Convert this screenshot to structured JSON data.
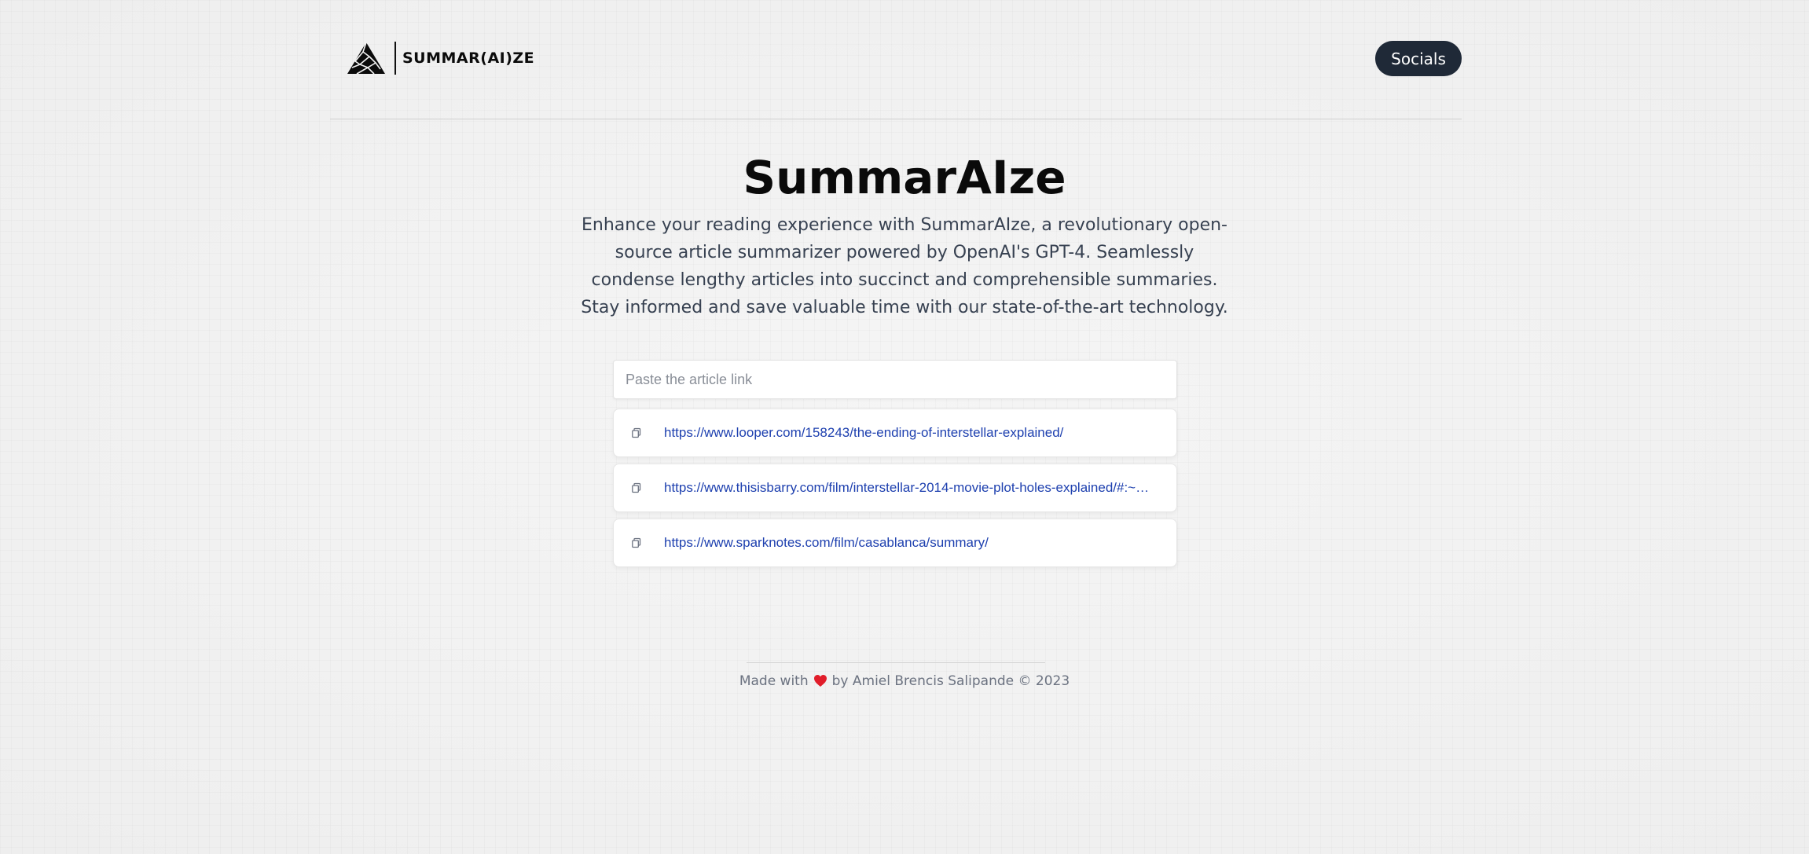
{
  "navbar": {
    "logo_text": "SUMMAR(AI)ZE",
    "socials_label": "Socials"
  },
  "hero": {
    "title": "SummarAIze",
    "description": "Enhance your reading experience with SummarAIze, a revolutionary open-source article summarizer powered by OpenAI's GPT-4. Seamlessly condense lengthy articles into succinct and comprehensible summaries. Stay informed and save valuable time with our state-of-the-art technology."
  },
  "search": {
    "placeholder": "Paste the article link",
    "value": ""
  },
  "history": [
    {
      "url": "https://www.looper.com/158243/the-ending-of-interstellar-explained/",
      "icon": "copy-icon"
    },
    {
      "url": "https://www.thisisbarry.com/film/interstellar-2014-movie-plot-holes-explained/#:~…",
      "icon": "copy-icon"
    },
    {
      "url": "https://www.sparknotes.com/film/casablanca/summary/",
      "icon": "copy-icon"
    }
  ],
  "footer": {
    "made_with": "Made with",
    "by_text": "by Amiel Brencis Salipande © 2023",
    "heart_color": "#e11d2a"
  },
  "colors": {
    "button_bg": "#1f2937",
    "link": "#1e40af",
    "heading": "#0a0a0a"
  }
}
